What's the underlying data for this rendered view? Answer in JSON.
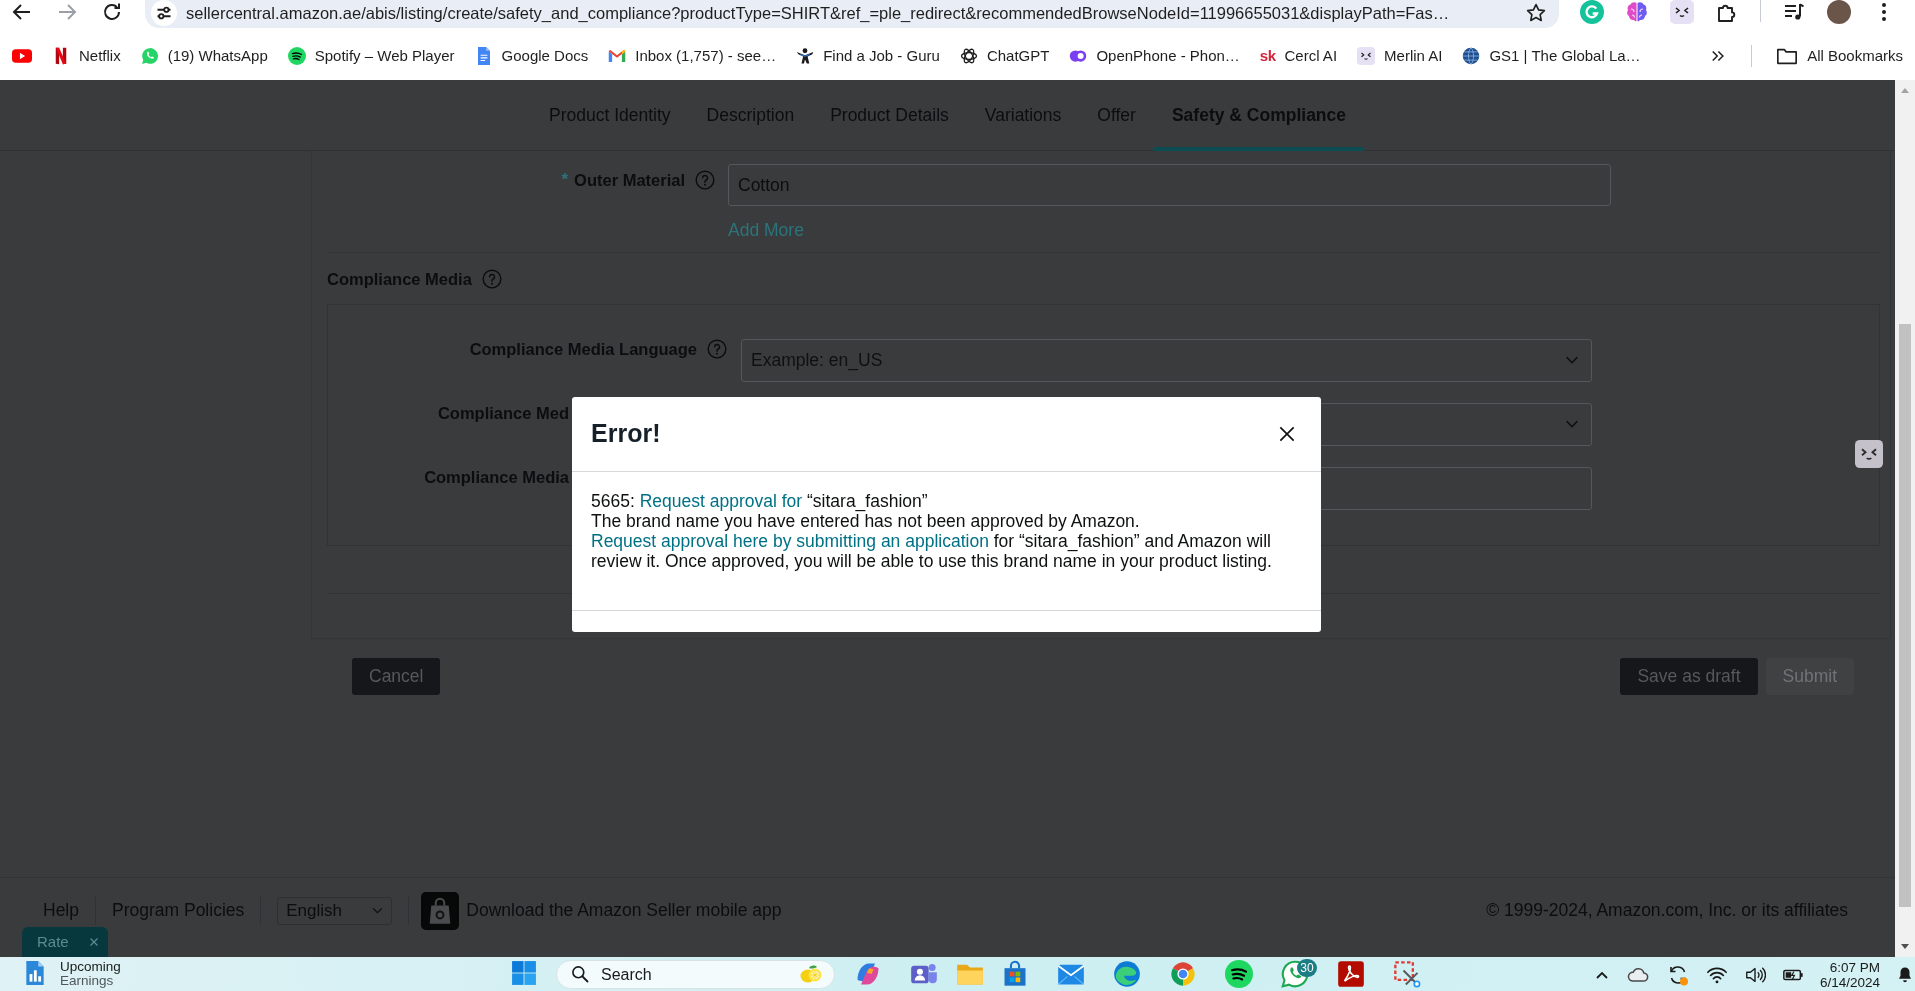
{
  "browser": {
    "url": "sellercentral.amazon.ae/abis/listing/create/safety_and_compliance?productType=SHIRT&ref_=ple_redirect&recommendedBrowseNodeId=11996655031&displayPath=Fas…",
    "bookmarks": [
      {
        "label": "Netflix"
      },
      {
        "label": "(19) WhatsApp"
      },
      {
        "label": "Spotify – Web Player"
      },
      {
        "label": "Google Docs"
      },
      {
        "label": "Inbox (1,757) - see…"
      },
      {
        "label": "Find a Job - Guru"
      },
      {
        "label": "ChatGPT"
      },
      {
        "label": "OpenPhone - Phon…"
      },
      {
        "label": "Cercl AI",
        "icon_text": "sk"
      },
      {
        "label": "Merlin AI"
      },
      {
        "label": "GS1 | The Global La…"
      }
    ],
    "all_bookmarks": "All Bookmarks"
  },
  "tabs": [
    {
      "label": "Product Identity",
      "selected": false
    },
    {
      "label": "Description",
      "selected": false
    },
    {
      "label": "Product Details",
      "selected": false
    },
    {
      "label": "Variations",
      "selected": false
    },
    {
      "label": "Offer",
      "selected": false
    },
    {
      "label": "Safety & Compliance",
      "selected": true
    }
  ],
  "outer_material": {
    "required_mark": "*",
    "label": "Outer Material",
    "value": "Cotton",
    "add_more": "Add More"
  },
  "compliance_media": {
    "title": "Compliance Media",
    "fields": [
      {
        "label": "Compliance Media Language",
        "kind": "select",
        "placeholder": "Example: en_US"
      },
      {
        "label": "Compliance Med",
        "kind": "select"
      },
      {
        "label": "Compliance Media",
        "kind": "input"
      }
    ]
  },
  "actions": {
    "cancel": "Cancel",
    "buttons": [
      {
        "label": "Save as draft",
        "disabled": false
      },
      {
        "label": "Submit",
        "disabled": true
      }
    ]
  },
  "footer": {
    "links": [
      "Help",
      "Program Policies"
    ],
    "language": "English",
    "app_promo": "Download the Amazon Seller mobile app",
    "copyright": "© 1999-2024, Amazon.com, Inc. or its affiliates"
  },
  "rate_tab": {
    "label": "Rate"
  },
  "dialog": {
    "title": "Error!",
    "paragraphs": [
      [
        {
          "kind": "text",
          "text": "5665: "
        },
        {
          "kind": "link",
          "text": "Request approval for"
        },
        {
          "kind": "text",
          "text": " “sitara_fashion”"
        }
      ],
      [
        {
          "kind": "text",
          "text": "The brand name you have entered has not been approved by Amazon. "
        },
        {
          "kind": "link",
          "text": "Request approval here by submitting an application"
        },
        {
          "kind": "text",
          "text": " for “sitara_fashion” and Amazon will review it. Once approved, you will be able to use this brand name in your product listing."
        }
      ]
    ]
  },
  "taskbar": {
    "widget": {
      "title": "Upcoming",
      "subtitle": "Earnings"
    },
    "search": {
      "placeholder": "Search"
    },
    "chat_badge": "30",
    "time": "6:07 PM",
    "date": "6/14/2024"
  }
}
